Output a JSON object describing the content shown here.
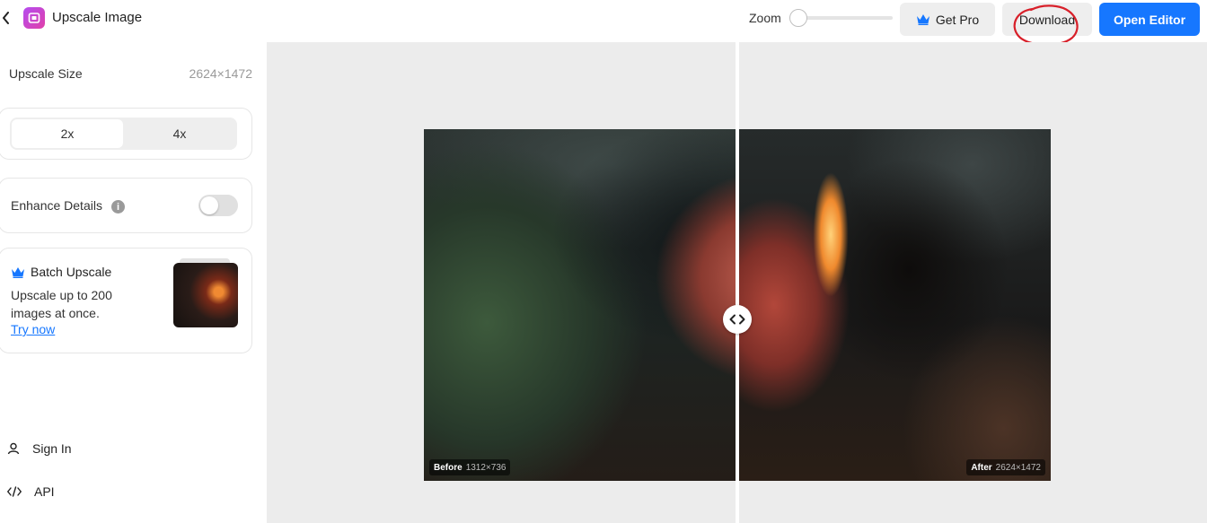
{
  "header": {
    "title": "Upscale Image",
    "zoom_label": "Zoom",
    "zoom_level": 0,
    "get_pro_label": "Get Pro",
    "download_label": "Download",
    "open_editor_label": "Open Editor"
  },
  "sidebar": {
    "upscale_size_label": "Upscale Size",
    "upscale_size_value": "2624×1472",
    "scale_options": [
      "2x",
      "4x"
    ],
    "selected_scale": "2x",
    "enhance_details_label": "Enhance Details",
    "enhance_details_enabled": false,
    "batch": {
      "title": "Batch Upscale",
      "description": "Upscale up to 200 images at once.",
      "link": "Try now"
    },
    "sign_in_label": "Sign In",
    "api_label": "API"
  },
  "canvas": {
    "before_label": "Before",
    "before_size": "1312×736",
    "after_label": "After",
    "after_size": "2624×1472",
    "background_color": "#ececec"
  },
  "colors": {
    "accent": "#1677ff",
    "annotation": "#d8202a"
  }
}
